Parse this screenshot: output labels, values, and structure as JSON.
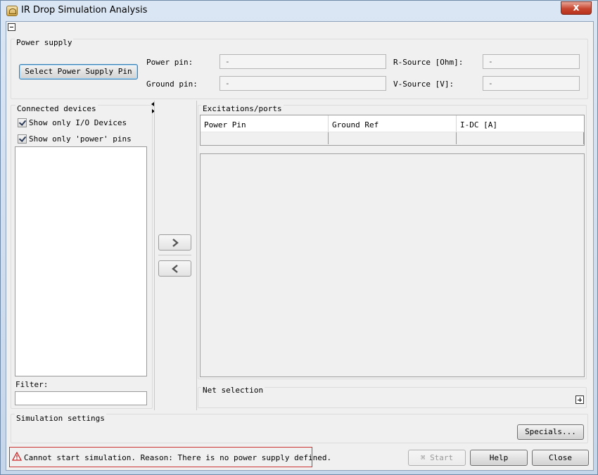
{
  "window": {
    "title": "IR Drop Simulation Analysis",
    "close_glyph": "x"
  },
  "power_supply": {
    "group_label": "Power supply",
    "select_button_label": "Select Power Supply Pin",
    "power_pin_label": "Power pin:",
    "power_pin_value": "-",
    "ground_pin_label": "Ground pin:",
    "ground_pin_value": "-",
    "r_source_label": "R-Source [Ohm]:",
    "r_source_value": "-",
    "v_source_label": "V-Source [V]:",
    "v_source_value": "-"
  },
  "connected_devices": {
    "group_label": "Connected devices",
    "show_io_label": "Show only I/O Devices",
    "show_io_checked": true,
    "show_power_label": "Show only 'power' pins",
    "show_power_checked": true,
    "filter_label": "Filter:",
    "filter_value": ""
  },
  "excitations": {
    "group_label": "Excitations/ports",
    "columns": [
      "Power Pin",
      "Ground Ref",
      "I-DC [A]"
    ]
  },
  "net_selection": {
    "group_label": "Net selection"
  },
  "simulation_settings": {
    "group_label": "Simulation settings",
    "specials_button_label": "Specials..."
  },
  "footer": {
    "status_message": "Cannot start simulation. Reason: There is no power supply defined.",
    "start_label": "Start",
    "help_label": "Help",
    "close_label": "Close"
  },
  "icons": {
    "warning": "warning-triangle-icon",
    "move_right": "chevron-right-icon",
    "move_left": "chevron-left-icon"
  },
  "colors": {
    "status_border": "#cc3333",
    "close_button": "#c7462f"
  }
}
